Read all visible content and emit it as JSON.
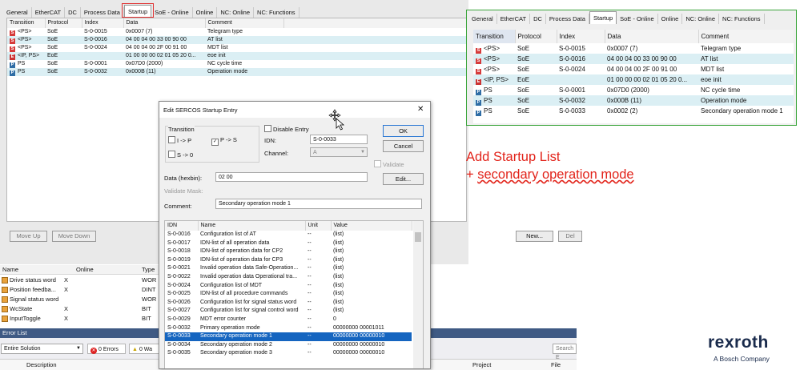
{
  "left_tabs": [
    "General",
    "EtherCAT",
    "DC",
    "Process Data",
    "Startup",
    "SoE - Online",
    "Online",
    "NC: Online",
    "NC: Functions"
  ],
  "startup_columns": [
    "Transition",
    "Protocol",
    "Index",
    "Data",
    "Comment"
  ],
  "startup_rows": [
    {
      "icon": "S",
      "transition": "<PS>",
      "protocol": "SoE",
      "index": "S-0-0015",
      "data": "0x0007 (7)",
      "comment": "Telegram type"
    },
    {
      "icon": "S",
      "transition": "<PS>",
      "protocol": "SoE",
      "index": "S-0-0016",
      "data": "04 00 04 00 33 00 90 00",
      "comment": "AT list"
    },
    {
      "icon": "S",
      "transition": "<PS>",
      "protocol": "SoE",
      "index": "S-0-0024",
      "data": "04 00 04 00 2F 00 91 00",
      "comment": "MDT list"
    },
    {
      "icon": "E",
      "transition": "<IP, PS>",
      "protocol": "EoE",
      "index": "",
      "data": "01 00 00 00 02 01 05 20 0...",
      "comment": "eoe init"
    },
    {
      "icon": "P",
      "transition": "PS",
      "protocol": "SoE",
      "index": "S-0-0001",
      "data": "0x07D0 (2000)",
      "comment": "NC cycle time"
    },
    {
      "icon": "P",
      "transition": "PS",
      "protocol": "SoE",
      "index": "S-0-0032",
      "data": "0x000B (11)",
      "comment": "Operation mode"
    }
  ],
  "left_buttons": {
    "move_up": "Move Up",
    "move_down": "Move Down",
    "new": "New...",
    "delete": "Del"
  },
  "vars_columns": [
    "Name",
    "Online",
    "Type"
  ],
  "vars_rows": [
    {
      "name": "Drive status word",
      "online": "X",
      "type": "WOR"
    },
    {
      "name": "Position feedba...",
      "online": "X",
      "type": "DINT"
    },
    {
      "name": "Signal status word",
      "online": "",
      "type": "WOR"
    },
    {
      "name": "WcState",
      "online": "X",
      "type": "BIT"
    },
    {
      "name": "InputToggle",
      "online": "X",
      "type": "BIT"
    }
  ],
  "error_list": {
    "title": "Error List",
    "scope": "Entire Solution",
    "errors": "0 Errors",
    "warnings": "0 Wa",
    "search": "Search E",
    "col_description": "Description",
    "col_project": "Project",
    "col_file": "File"
  },
  "dialog": {
    "title": "Edit SERCOS Startup Entry",
    "close": "✕",
    "transition_label": "Transition",
    "ip": "I -> P",
    "ps": "P -> S",
    "s0": "S -> 0",
    "ps_checked": "✓",
    "disable_entry": "Disable Entry",
    "idn_label": "IDN:",
    "idn_value": "S-0-0033",
    "channel_label": "Channel:",
    "channel_value": "A",
    "validate": "Validate",
    "ok": "OK",
    "cancel": "Cancel",
    "edit": "Edit...",
    "data_label": "Data (hexbin):",
    "data_value": "02 00",
    "validate_mask": "Validate Mask:",
    "comment_label": "Comment:",
    "comment_value": "Secondary operation mode 1",
    "list_columns": [
      "IDN",
      "Name",
      "Unit",
      "Value"
    ],
    "list_rows": [
      [
        "S-0-0016",
        "Configuration list of AT",
        "--",
        "(list)"
      ],
      [
        "S-0-0017",
        "IDN-list of all operation data",
        "--",
        "(list)"
      ],
      [
        "S-0-0018",
        "IDN-list of operation data for CP2",
        "--",
        "(list)"
      ],
      [
        "S-0-0019",
        "IDN-list of operation data for CP3",
        "--",
        "(list)"
      ],
      [
        "S-0-0021",
        "Invalid operation data Safe-Operation...",
        "--",
        "(list)"
      ],
      [
        "S-0-0022",
        "Invalid operation data Operational tra...",
        "--",
        "(list)"
      ],
      [
        "S-0-0024",
        "Configuration list of MDT",
        "--",
        "(list)"
      ],
      [
        "S-0-0025",
        "IDN-list of all procedure commands",
        "--",
        "(list)"
      ],
      [
        "S-0-0026",
        "Configuration list for signal status word",
        "--",
        "(list)"
      ],
      [
        "S-0-0027",
        "Configuration list for signal control word",
        "--",
        "(list)"
      ],
      [
        "S-0-0029",
        "MDT error counter",
        "--",
        "0"
      ],
      [
        "S-0-0032",
        "Primary operation mode",
        "--",
        "00000000 00001011"
      ],
      [
        "S-0-0033",
        "Secondary operation mode 1",
        "--",
        "00000000 00000010"
      ],
      [
        "S-0-0034",
        "Secondary operation mode 2",
        "--",
        "00000000 00000010"
      ],
      [
        "S-0-0035",
        "Secondary operation mode 3",
        "--",
        "00000000 00000010"
      ]
    ],
    "selected_index": 12
  },
  "inset_tabs": [
    "General",
    "EtherCAT",
    "DC",
    "Process Data",
    "Startup",
    "SoE - Online",
    "Online",
    "NC: Online",
    "NC: Functions"
  ],
  "inset_rows": [
    {
      "icon": "S",
      "transition": "<PS>",
      "protocol": "SoE",
      "index": "S-0-0015",
      "data": "0x0007 (7)",
      "comment": "Telegram type"
    },
    {
      "icon": "S",
      "transition": "<PS>",
      "protocol": "SoE",
      "index": "S-0-0016",
      "data": "04 00 04 00 33 00 90 00",
      "comment": "AT list"
    },
    {
      "icon": "S",
      "transition": "<PS>",
      "protocol": "SoE",
      "index": "S-0-0024",
      "data": "04 00 04 00 2F 00 91 00",
      "comment": "MDT list"
    },
    {
      "icon": "E",
      "transition": "<IP, PS>",
      "protocol": "EoE",
      "index": "",
      "data": "01 00 00 00 02 01 05 20 0...",
      "comment": "eoe init"
    },
    {
      "icon": "P",
      "transition": "PS",
      "protocol": "SoE",
      "index": "S-0-0001",
      "data": "0x07D0 (2000)",
      "comment": "NC cycle time"
    },
    {
      "icon": "P",
      "transition": "PS",
      "protocol": "SoE",
      "index": "S-0-0032",
      "data": "0x000B (11)",
      "comment": "Operation mode"
    },
    {
      "icon": "P",
      "transition": "PS",
      "protocol": "SoE",
      "index": "S-0-0033",
      "data": "0x0002 (2)",
      "comment": "Secondary operation mode 1"
    }
  ],
  "annotation": {
    "line1": "Add Startup List",
    "line2_prefix": "+ ",
    "line2_underlined": "secondary operation mode"
  },
  "brand": {
    "name": "rexroth",
    "tagline": "A Bosch Company"
  },
  "colors": {
    "annotation_red": "#e2231a",
    "highlight_red": "#e03030",
    "inset_green": "#3aa53a",
    "selection_blue": "#1565c0",
    "row_alt": "#dbeff4"
  }
}
